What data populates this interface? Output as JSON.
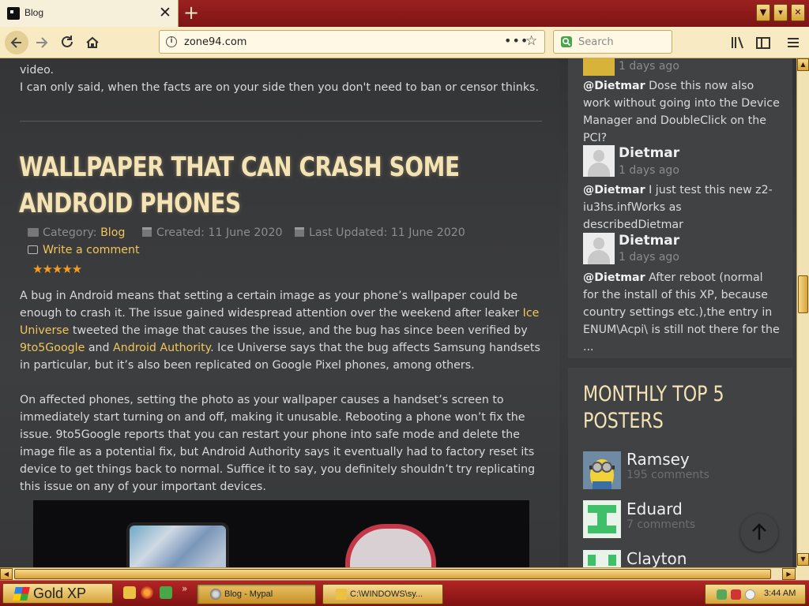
{
  "browser": {
    "tab": {
      "title": "Blog"
    },
    "url": "zone94.com",
    "search_placeholder": "Search",
    "url_menu_glyph": "•••",
    "new_tab_glyph": "+",
    "close_glyph": "✕"
  },
  "article_intro": {
    "line1": "video.",
    "line2": "I can only said, when the facts are on your side then you don't need to ban or censor thinks."
  },
  "article": {
    "title": "WALLPAPER THAT CAN CRASH SOME ANDROID PHONES",
    "category_label": "Category:",
    "category_value": "Blog",
    "created": "Created: 11 June 2020",
    "updated": "Last Updated: 11 June 2020",
    "write_comment": "Write a comment",
    "rating": 4.5,
    "stars_text": "★★★★★",
    "p1_a": "A bug in Android means that setting a certain image as your phone’s wallpaper could be enough to crash it. The issue gained widespread attention over the weekend after leaker ",
    "p1_link1": "Ice Universe",
    "p1_b": " tweeted the image that causes the issue, and the bug has since been verified by ",
    "p1_link2": "9to5Google",
    "p1_c": " and ",
    "p1_link3": "Android Authority",
    "p1_d": ". Ice Universe says that the bug affects Samsung handsets in particular, but it’s also been replicated on Google Pixel phones, among others.",
    "p2": "On affected phones, setting the photo as your wallpaper causes a handset’s screen to immediately start turning on and off, making it unusable. Rebooting a phone won’t fix the issue. 9to5Google reports that you can restart your phone into safe mode and delete the image file as a potential fix, but Android Authority says it eventually had to factory reset its device to get things back to normal. Suffice it to say, you definitely shouldn’t try replicating this issue on any of your important devices."
  },
  "sidebar": {
    "comments": [
      {
        "name": "",
        "date": "1 days ago",
        "mention": "@Dietmar",
        "text": " Dose this now also work without going into the Device Manager and DoubleClick on the PCI?"
      },
      {
        "name": "Dietmar",
        "date": "1 days ago",
        "mention": "@Dietmar",
        "text": " I just test this new z2-iu3hs.infWorks as describedDietmar"
      },
      {
        "name": "Dietmar",
        "date": "1 days ago",
        "mention": "@Dietmar",
        "text": " After reboot (normal for the install of this XP, because country settings etc.),the entry in ENUM\\Acpi\\ is still not there for the ..."
      }
    ],
    "posters_title": "MONTHLY TOP 5 POSTERS",
    "posters": [
      {
        "name": "Ramsey",
        "count": "195 comments"
      },
      {
        "name": "Eduard",
        "count": "7 comments"
      },
      {
        "name": "Clayton",
        "count": ""
      }
    ]
  },
  "taskbar": {
    "start_label": "Gold XP",
    "tasks": [
      {
        "label": "Blog - Mypal"
      },
      {
        "label": "C:\\WINDOWS\\sy..."
      }
    ],
    "quicklaunch_more": "»",
    "clock": "3:44 AM"
  },
  "colors": {
    "accent": "#f2c65a",
    "title": "#f4e3b5",
    "taskbar": "#9b1b1b"
  }
}
